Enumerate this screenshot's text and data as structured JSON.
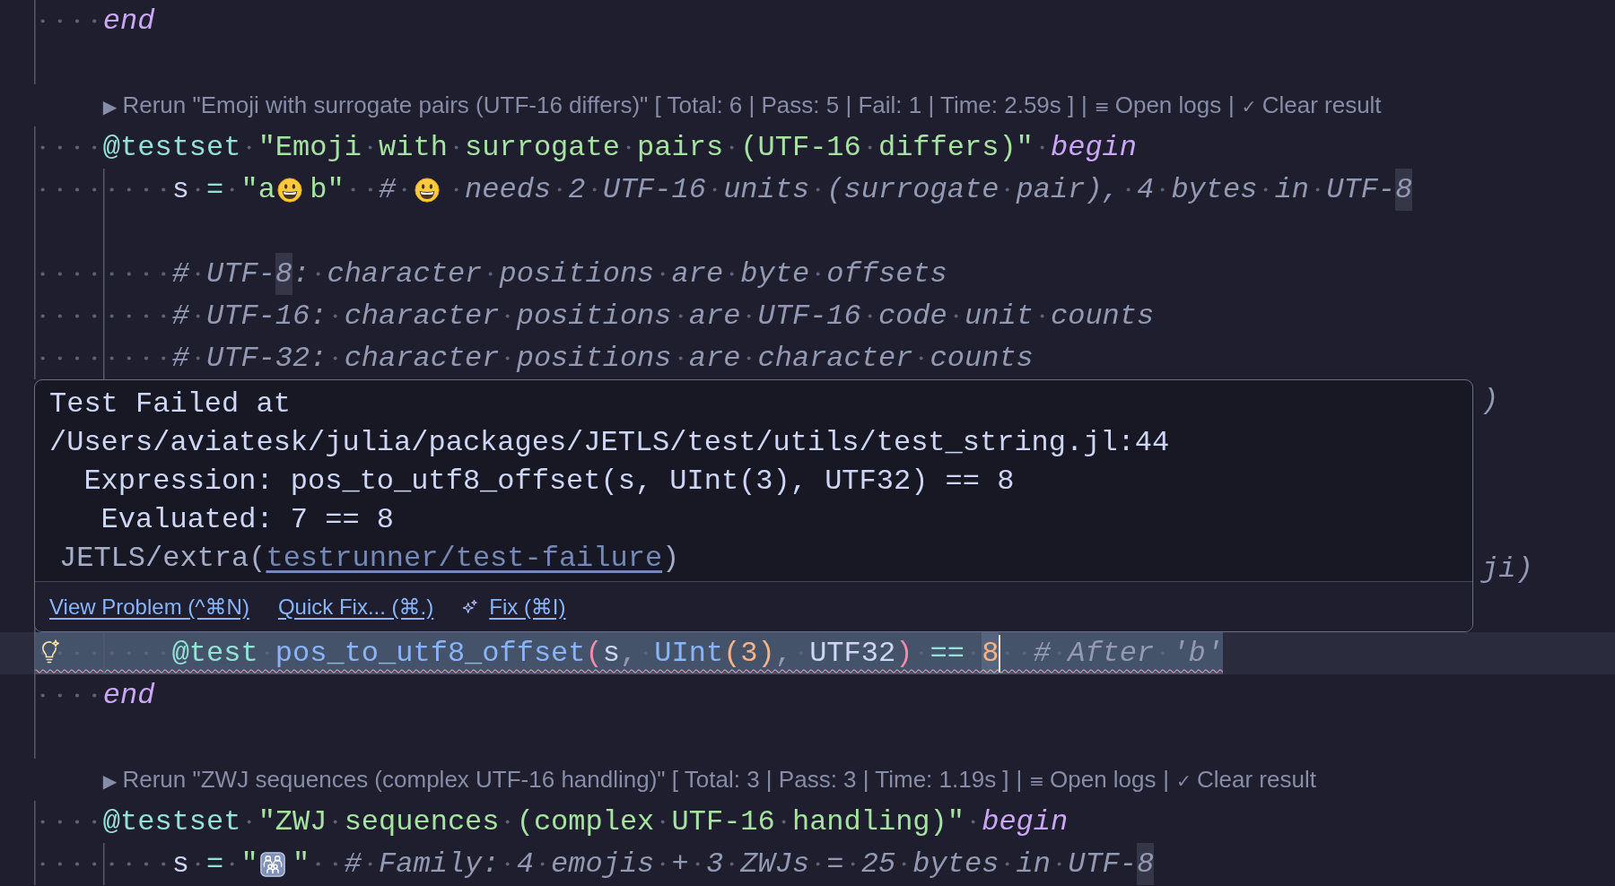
{
  "editor": {
    "lines": [
      {
        "kind": "code",
        "tokens": [
          {
            "text": "end",
            "kind": "keyword",
            "match": false
          }
        ]
      },
      {
        "kind": "blank"
      },
      {
        "kind": "lens",
        "separator": "|",
        "items": [
          {
            "icon": "▶",
            "label": "Rerun \"Emoji with surrogate pairs (UTF-16 differs)\" [ Total: 6 | Pass: 5 | Fail: 1 | Time: 2.59s ]"
          },
          {
            "icon": "≡",
            "label": "Open logs"
          },
          {
            "icon": "✓",
            "label": "Clear result"
          }
        ]
      },
      {
        "kind": "code",
        "tokens": [
          {
            "text": "@testset",
            "kind": "macro",
            "match": false
          },
          {
            "text": " \"Emoji with surrogate pairs (UTF-16 differs)\"",
            "kind": "string",
            "match": false
          },
          {
            "text": " begin",
            "kind": "keyword",
            "match": false
          }
        ],
        "children": [
          {
            "kind": "code",
            "tokens": [
              {
                "text": "s",
                "kind": "variable",
                "match": false
              },
              {
                "text": " = ",
                "kind": "operator",
                "match": false
              },
              {
                "text": "\"a",
                "kind": "string",
                "match": false
              },
              {
                "kind": "smiley"
              },
              {
                "text": "b\"",
                "kind": "string",
                "match": false
              },
              {
                "text": "  # ",
                "kind": "comment",
                "match": false
              },
              {
                "kind": "smiley"
              },
              {
                "text": " needs 2 UTF-16 units (surrogate pair), 4 bytes in UTF-",
                "kind": "comment",
                "match": false
              },
              {
                "text": "8",
                "kind": "comment",
                "match": true
              }
            ]
          },
          {
            "kind": "blank"
          },
          {
            "kind": "code",
            "tokens": [
              {
                "text": "# UTF-",
                "kind": "comment",
                "match": false
              },
              {
                "text": "8",
                "kind": "comment",
                "match": true
              },
              {
                "text": ": character positions are byte offsets",
                "kind": "comment",
                "match": false
              }
            ]
          },
          {
            "kind": "code",
            "tokens": [
              {
                "text": "# UTF-16: character positions are UTF-16 code unit counts",
                "kind": "comment",
                "match": false
              }
            ]
          },
          {
            "kind": "code",
            "tokens": [
              {
                "text": "# UTF-32: character positions are character counts",
                "kind": "comment",
                "match": false
              }
            ]
          },
          {
            "kind": "covered",
            "tokens": [
              {
                "text": ")",
                "kind": "comment",
                "match": false
              }
            ]
          },
          {
            "kind": "blank"
          },
          {
            "kind": "blank"
          },
          {
            "kind": "blank"
          },
          {
            "kind": "covered",
            "tokens": [
              {
                "text": "ji)",
                "kind": "comment",
                "match": false
              }
            ]
          },
          {
            "kind": "blank"
          },
          {
            "kind": "failing",
            "tokens": [
              {
                "text": "@test",
                "kind": "macro",
                "match": false
              },
              {
                "text": " pos_to_utf8_offset",
                "kind": "function",
                "match": false
              },
              {
                "text": "(",
                "kind": "bracket",
                "match": false
              },
              {
                "text": "s",
                "kind": "variable",
                "match": false
              },
              {
                "text": ", ",
                "kind": "punct",
                "match": false
              },
              {
                "text": "UInt",
                "kind": "function",
                "match": false
              },
              {
                "text": "(",
                "kind": "nested",
                "match": false
              },
              {
                "text": "3",
                "kind": "number",
                "match": false
              },
              {
                "text": ")",
                "kind": "nested",
                "match": false
              },
              {
                "text": ", ",
                "kind": "punct",
                "match": false
              },
              {
                "text": "UTF32",
                "kind": "variable",
                "match": false
              },
              {
                "text": ")",
                "kind": "bracket",
                "match": false
              },
              {
                "text": " == ",
                "kind": "operator",
                "match": false
              },
              {
                "text": "8",
                "kind": "number",
                "match": true
              },
              {
                "text": "  # After 'b'",
                "kind": "comment",
                "match": false
              }
            ]
          }
        ]
      },
      {
        "kind": "code",
        "tokens": [
          {
            "text": "end",
            "kind": "keyword",
            "match": false
          }
        ]
      },
      {
        "kind": "blank"
      },
      {
        "kind": "lens",
        "separator": "|",
        "items": [
          {
            "icon": "▶",
            "label": "Rerun \"ZWJ sequences (complex UTF-16 handling)\" [ Total: 3 | Pass: 3 | Time: 1.19s ]"
          },
          {
            "icon": "≡",
            "label": "Open logs"
          },
          {
            "icon": "✓",
            "label": "Clear result"
          }
        ]
      },
      {
        "kind": "code",
        "tokens": [
          {
            "text": "@testset",
            "kind": "macro",
            "match": false
          },
          {
            "text": " \"ZWJ sequences (complex UTF-16 handling)\"",
            "kind": "string",
            "match": false
          },
          {
            "text": " begin",
            "kind": "keyword",
            "match": false
          }
        ],
        "children": [
          {
            "kind": "code",
            "tokens": [
              {
                "text": "s",
                "kind": "variable",
                "match": false
              },
              {
                "text": " = ",
                "kind": "operator",
                "match": false
              },
              {
                "text": "\"",
                "kind": "string",
                "match": false
              },
              {
                "kind": "family"
              },
              {
                "text": "\"",
                "kind": "string",
                "match": false
              },
              {
                "text": "  # Family: 4 emojis + 3 ZWJs = 25 bytes in UTF-",
                "kind": "comment",
                "match": false
              },
              {
                "text": "8",
                "kind": "comment",
                "match": true
              }
            ]
          }
        ]
      }
    ]
  },
  "hover": {
    "message": [
      "Test Failed at",
      "/Users/aviatesk/julia/packages/JETLS/test/utils/test_string.jl:44",
      "  Expression: pos_to_utf8_offset(s, UInt(3), UTF32) == 8",
      "   Evaluated: 7 == 8"
    ],
    "source": {
      "before": "JETLS/extra(",
      "link": "testrunner/test-failure",
      "after": ")"
    },
    "actions": [
      {
        "kind": "plain",
        "label": "View Problem (^⌘N)"
      },
      {
        "kind": "plain",
        "label": "Quick Fix... (⌘.)"
      },
      {
        "kind": "ai",
        "label": "Fix (⌘I)"
      }
    ]
  }
}
